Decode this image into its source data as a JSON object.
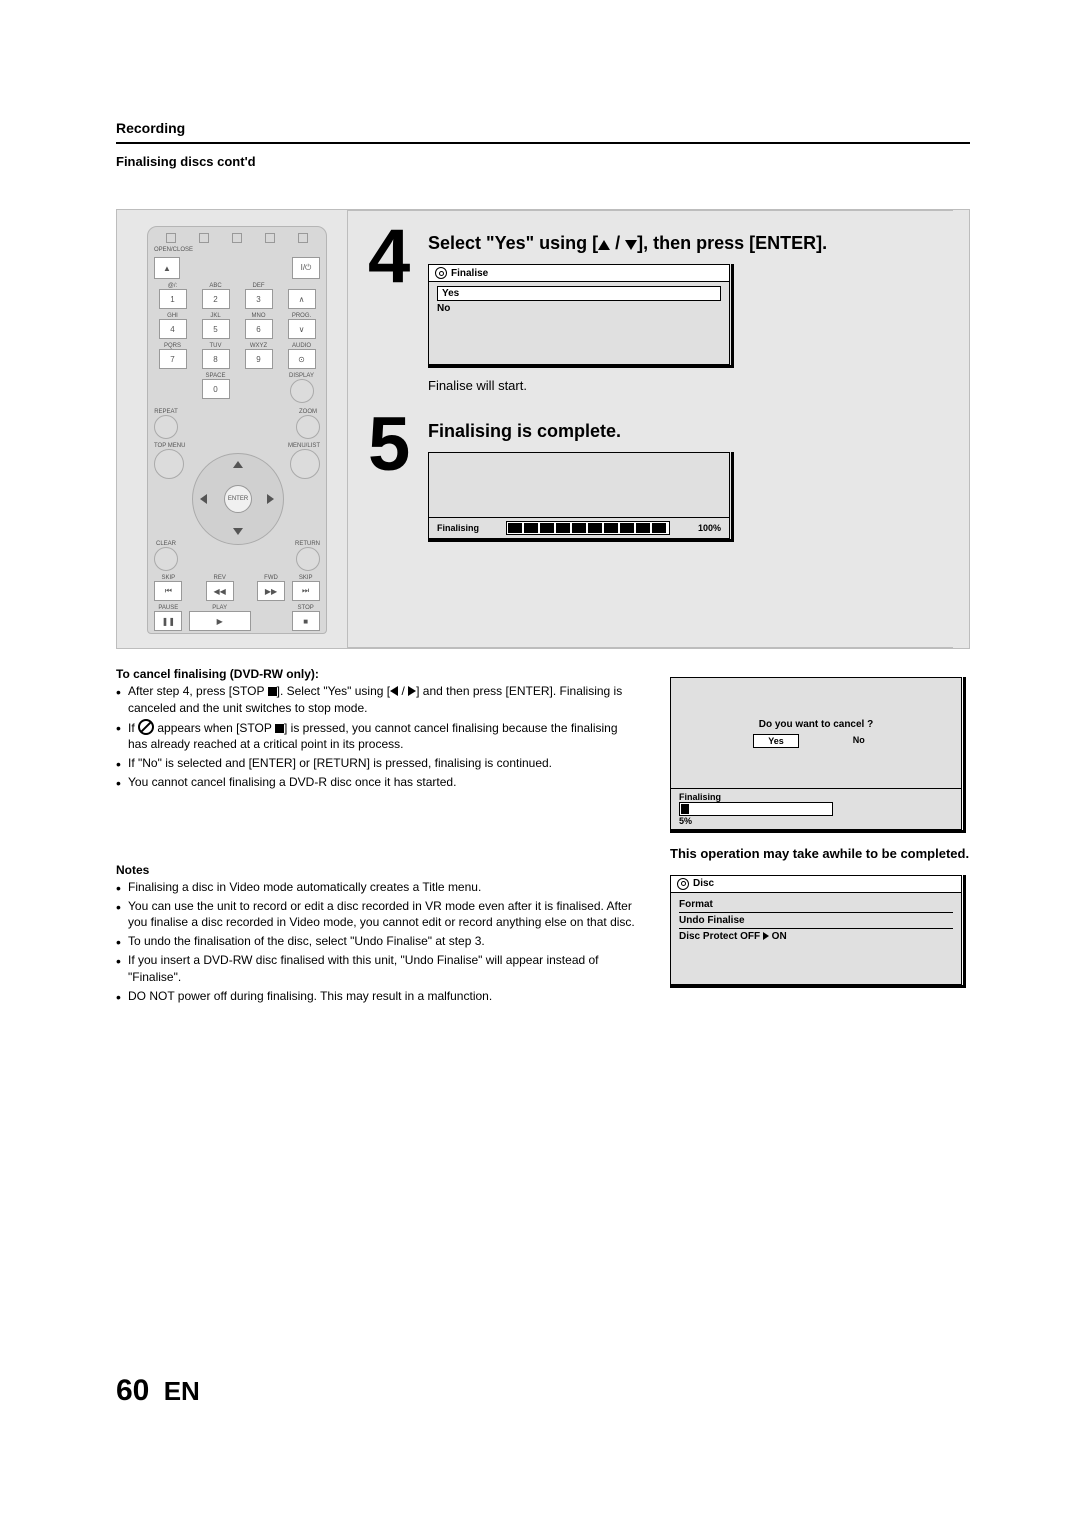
{
  "header": {
    "section": "Recording",
    "subsection": "Finalising discs cont'd"
  },
  "remote": {
    "topLabels": [
      "OPEN/CLOSE"
    ],
    "powerSym": "I/⏻",
    "keypad": [
      {
        "sub": "@/:",
        "key": "1"
      },
      {
        "sub": "ABC",
        "key": "2"
      },
      {
        "sub": "DEF",
        "key": "3"
      },
      {
        "sub": "",
        "key": "⌃"
      },
      {
        "sub": "GHI",
        "key": "4"
      },
      {
        "sub": "JKL",
        "key": "5"
      },
      {
        "sub": "MNO",
        "key": "6"
      },
      {
        "sub": "PROG.",
        "key": "⌄"
      },
      {
        "sub": "PQRS",
        "key": "7"
      },
      {
        "sub": "TUV",
        "key": "8"
      },
      {
        "sub": "WXYZ",
        "key": "9"
      },
      {
        "sub": "AUDIO",
        "key": "⊙"
      },
      {
        "sub": "",
        "key": ""
      },
      {
        "sub": "SPACE",
        "key": "0"
      },
      {
        "sub": "",
        "key": ""
      },
      {
        "sub": "DISPLAY",
        "key": ""
      }
    ],
    "midLabels": {
      "left": "REPEAT",
      "right": "ZOOM"
    },
    "menuLabels": {
      "left": "TOP MENU",
      "right": "MENU/LIST"
    },
    "dpadCenter": "ENTER",
    "lowerLabels": {
      "left": "CLEAR",
      "right": "RETURN"
    },
    "transport": [
      {
        "label": "SKIP",
        "sym": "⏮"
      },
      {
        "label": "REV",
        "sym": "◀◀"
      },
      {
        "label": "FWD",
        "sym": "▶▶"
      },
      {
        "label": "SKIP",
        "sym": "⏭"
      },
      {
        "label": "PAUSE",
        "sym": "❚❚"
      },
      {
        "label": "PLAY",
        "sym": "▶"
      },
      {
        "label": "",
        "sym": ""
      },
      {
        "label": "STOP",
        "sym": "■"
      }
    ]
  },
  "step4": {
    "num": "4",
    "titleA": "Select \"Yes\" using [",
    "titleB": " / ",
    "titleC": "], then press [ENTER].",
    "osdTitle": "Finalise",
    "osdYes": "Yes",
    "osdNo": "No",
    "belowText": "Finalise will start."
  },
  "step5": {
    "num": "5",
    "title": "Finalising is complete.",
    "pbarLabel": "Finalising",
    "pbarPct": "100%"
  },
  "cancelBlock": {
    "title": "To cancel finalising (DVD-RW only):",
    "items": [
      "After step 4, press [STOP ■]. Select \"Yes\" using [◀ / ▶] and then press [ENTER]. Finalising is canceled and the unit switches to stop mode.",
      "If ⊘ appears when [STOP ■] is pressed, you cannot cancel finalising because the finalising has already reached at a critical point in its process.",
      "If \"No\" is selected and [ENTER] or [RETURN] is pressed, finalising is continued.",
      "You cannot cancel finalising a DVD-R disc once it has started."
    ]
  },
  "notesBlock": {
    "title": "Notes",
    "items": [
      "Finalising a disc in Video mode automatically creates a Title menu.",
      "You can use the unit to record or edit a disc recorded in VR mode even after it is finalised. After you finalise a disc recorded in Video mode, you cannot edit or record anything else on that disc.",
      "To undo the finalisation of the disc, select \"Undo Finalise\" at step 3.",
      "If you insert a DVD-RW disc finalised with this unit, \"Undo Finalise\" will appear instead of \"Finalise\".",
      "DO NOT power off during finalising. This may result in a malfunction."
    ]
  },
  "cancelOsd": {
    "q": "Do you want to cancel ?",
    "yes": "Yes",
    "no": "No",
    "pbarLabel": "Finalising",
    "pbarPct": "5%"
  },
  "rightNote": "This operation may take awhile to be completed.",
  "discMenu": {
    "title": "Disc",
    "row1": "Format",
    "row2": "Undo Finalise",
    "row3a": "Disc Protect OFF ",
    "row3b": " ON"
  },
  "footer": {
    "page": "60",
    "lang": "EN"
  }
}
